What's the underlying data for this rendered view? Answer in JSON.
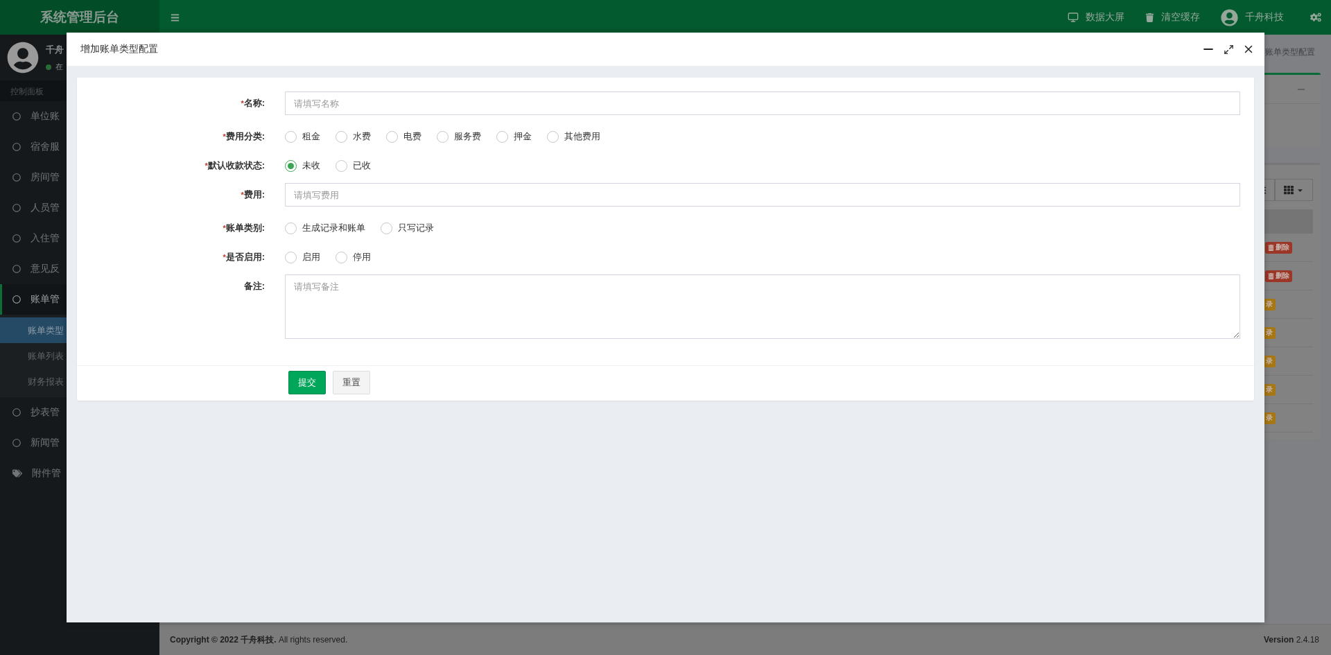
{
  "header": {
    "logo": "系统管理后台",
    "actions": [
      {
        "kind": "screen",
        "label": "数据大屏"
      },
      {
        "kind": "trash",
        "label": "清空缓存"
      }
    ],
    "user": "千舟科技"
  },
  "sidebar": {
    "user": {
      "name": "千舟",
      "status": "在"
    },
    "section": "控制面板",
    "items": [
      {
        "kind": "circle",
        "label": "单位账",
        "selected": false
      },
      {
        "kind": "circle",
        "label": "宿舍服",
        "selected": false
      },
      {
        "kind": "circle",
        "label": "房间管",
        "selected": false
      },
      {
        "kind": "circle",
        "label": "人员管",
        "selected": false
      },
      {
        "kind": "circle",
        "label": "入住管",
        "selected": false
      },
      {
        "kind": "circle",
        "label": "意见反",
        "selected": false
      },
      {
        "kind": "circle",
        "label": "账单管",
        "selected": true,
        "children": [
          {
            "label": "账单类型",
            "selected": true
          },
          {
            "label": "账单列表",
            "selected": false
          },
          {
            "label": "财务报表",
            "selected": false
          }
        ]
      },
      {
        "kind": "circle",
        "label": "抄表管",
        "selected": false
      },
      {
        "kind": "circle",
        "label": "新闻管",
        "selected": false
      },
      {
        "kind": "tag",
        "label": "附件管",
        "selected": false
      }
    ]
  },
  "content": {
    "tab": "账单类型配置",
    "rows": [
      {
        "kind": "delete",
        "label": "删除"
      },
      {
        "kind": "delete",
        "label": "删除"
      },
      {
        "kind": "record",
        "label": "录"
      },
      {
        "kind": "record",
        "label": "录"
      },
      {
        "kind": "record",
        "label": "录"
      },
      {
        "kind": "record",
        "label": "录"
      },
      {
        "kind": "record",
        "label": "录"
      }
    ]
  },
  "modal": {
    "title": "增加账单类型配置",
    "fields": [
      {
        "kind": "text",
        "mark": "*",
        "label": "名称:",
        "placeholder": "请填写名称"
      },
      {
        "kind": "radio",
        "mark": "*",
        "label": "费用分类:",
        "options": [
          {
            "label": "租金",
            "selected": false
          },
          {
            "label": "水费",
            "selected": false
          },
          {
            "label": "电费",
            "selected": false
          },
          {
            "label": "服务费",
            "selected": false
          },
          {
            "label": "押金",
            "selected": false
          },
          {
            "label": "其他费用",
            "selected": false
          }
        ]
      },
      {
        "kind": "radio",
        "mark": "*",
        "label": "默认收款状态:",
        "options": [
          {
            "label": "未收",
            "selected": true
          },
          {
            "label": "已收",
            "selected": false
          }
        ]
      },
      {
        "kind": "text",
        "mark": "*",
        "label": "费用:",
        "placeholder": "请填写费用"
      },
      {
        "kind": "radio",
        "mark": "*",
        "label": "账单类别:",
        "options": [
          {
            "label": "生成记录和账单",
            "selected": false
          },
          {
            "label": "只写记录",
            "selected": false
          }
        ]
      },
      {
        "kind": "radio",
        "mark": "*",
        "label": "是否启用:",
        "options": [
          {
            "label": "启用",
            "selected": false
          },
          {
            "label": "停用",
            "selected": false
          }
        ]
      },
      {
        "kind": "textarea",
        "label": "备注:",
        "placeholder": "请填写备注"
      }
    ],
    "buttons": [
      {
        "kind": "primary",
        "label": "提交"
      },
      {
        "kind": "default",
        "label": "重置"
      }
    ]
  },
  "footer": {
    "copyright": "**Copyright © 2022 千舟科技.** All rights reserved.",
    "version": "**Version** 2.4.18"
  }
}
